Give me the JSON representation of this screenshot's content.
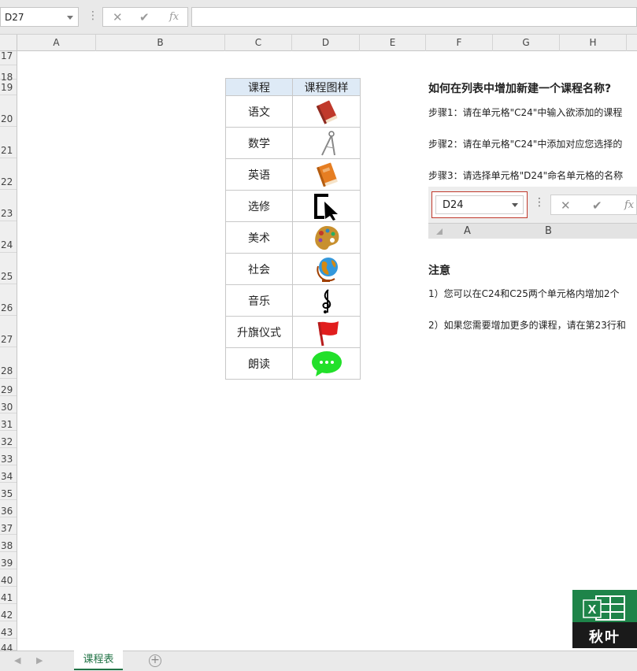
{
  "formula_bar": {
    "name_box": "D27",
    "cancel_icon": "✕",
    "enter_icon": "✔",
    "fx_label": "fx",
    "formula": ""
  },
  "columns": [
    "A",
    "B",
    "C",
    "D",
    "E",
    "F",
    "G",
    "H"
  ],
  "rows": [
    "17",
    "18",
    "19",
    "20",
    "21",
    "22",
    "23",
    "24",
    "25",
    "26",
    "27",
    "28",
    "29",
    "30",
    "31",
    "32",
    "33",
    "34",
    "35",
    "36",
    "37",
    "38",
    "39",
    "40",
    "41",
    "42",
    "43",
    "44"
  ],
  "table": {
    "headers": [
      "课程",
      "课程图样"
    ],
    "rows": [
      {
        "name": "语文",
        "icon": "red-book-icon"
      },
      {
        "name": "数学",
        "icon": "compass-icon"
      },
      {
        "name": "英语",
        "icon": "orange-book-icon"
      },
      {
        "name": "选修",
        "icon": "cursor-select-icon"
      },
      {
        "name": "美术",
        "icon": "palette-icon"
      },
      {
        "name": "社会",
        "icon": "globe-icon"
      },
      {
        "name": "音乐",
        "icon": "treble-clef-icon"
      },
      {
        "name": "升旗仪式",
        "icon": "red-flag-icon"
      },
      {
        "name": "朗读",
        "icon": "green-chat-bubble-icon"
      }
    ],
    "header_bg": "#deeaf6"
  },
  "instructions": {
    "title": "如何在列表中增加新建一个课程名称?",
    "steps": [
      "步骤1：请在单元格\"C24\"中输入欲添加的课程",
      "步骤2：请在单元格\"C24\"中添加对应您选择的",
      "步骤3：请选择单元格\"D24\"命名单元格的名称"
    ],
    "mini_screenshot": {
      "name_box": "D24",
      "col_a": "A",
      "col_b": "B"
    },
    "note_title": "注意",
    "notes": [
      "1）您可以在C24和C25两个单元格内增加2个",
      "2）如果您需要增加更多的课程，请在第23行和"
    ]
  },
  "logo": {
    "text": "秋叶",
    "accent": "#1e8449"
  },
  "sheet_tabs": {
    "active": "课程表",
    "add_icon": "+"
  }
}
